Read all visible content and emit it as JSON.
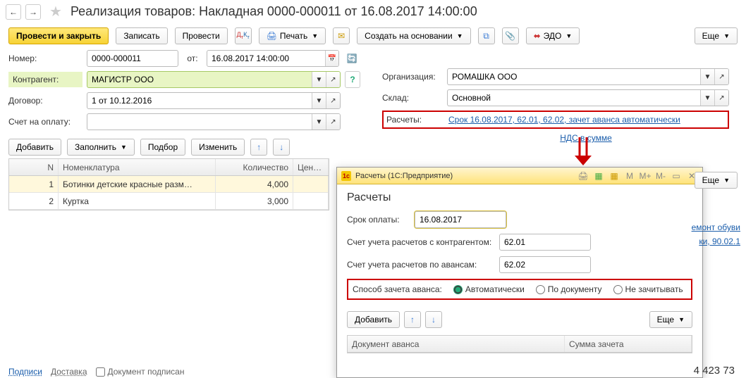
{
  "header": {
    "title": "Реализация товаров: Накладная 0000-000011 от 16.08.2017 14:00:00"
  },
  "toolbar": {
    "post_close": "Провести и закрыть",
    "write": "Записать",
    "post": "Провести",
    "dtdk": "Дт\nКт",
    "print": "Печать",
    "create_based": "Создать на основании",
    "edo": "ЭДО",
    "more": "Еще"
  },
  "form": {
    "number_label": "Номер:",
    "number": "0000-000011",
    "from_label": "от:",
    "date": "16.08.2017 14:00:00",
    "org_label": "Организация:",
    "org": "РОМАШКА ООО",
    "counterparty_label": "Контрагент:",
    "counterparty": "МАГИСТР ООО",
    "warehouse_label": "Склад:",
    "warehouse": "Основной",
    "contract_label": "Договор:",
    "contract": "1 от 10.12.2016",
    "settlements_label": "Расчеты:",
    "settlements_link": "Срок 16.08.2017, 62.01, 62.02, зачет аванса автоматически",
    "invoice_label": "Счет на оплату:",
    "invoice": "",
    "nds_link": "НДС в сумме"
  },
  "list_toolbar": {
    "add": "Добавить",
    "fill": "Заполнить",
    "pick": "Подбор",
    "change": "Изменить",
    "more": "Еще"
  },
  "table": {
    "cols": {
      "n": "N",
      "nom": "Номенклатура",
      "qty": "Количество",
      "price": "Цен…"
    },
    "rows": [
      {
        "n": "1",
        "nom": "Ботинки детские красные разм…",
        "qty": "4,000",
        "price": ""
      },
      {
        "n": "2",
        "nom": "Куртка",
        "qty": "3,000",
        "price": ""
      }
    ]
  },
  "dialog": {
    "window_title": "Расчеты  (1С:Предприятие)",
    "title": "Расчеты",
    "payment_term_label": "Срок оплаты:",
    "payment_term": "16.08.2017",
    "account_counterparty_label": "Счет учета расчетов с контрагентом:",
    "account_counterparty": "62.01",
    "account_advance_label": "Счет учета расчетов по авансам:",
    "account_advance": "62.02",
    "advance_method_label": "Способ зачета аванса:",
    "advance_opts": {
      "auto": "Автоматически",
      "by_doc": "По документу",
      "none": "Не зачитывать"
    },
    "add": "Добавить",
    "more": "Еще",
    "col_doc": "Документ аванса",
    "col_sum": "Сумма зачета"
  },
  "footer": {
    "signs": "Подписи",
    "delivery": "Доставка",
    "doc_signed": "Документ подписан",
    "total": "4 423 73"
  },
  "side": {
    "l1": "емонт обуви",
    "l2": "ки, 90.02.1"
  }
}
